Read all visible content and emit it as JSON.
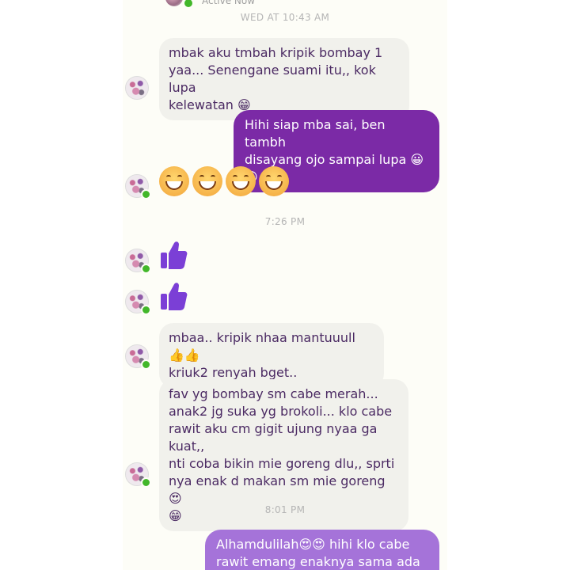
{
  "header": {
    "status": "Active Now"
  },
  "timestamps": {
    "t1": "WED AT 10:43 AM",
    "t2": "7:26 PM",
    "t3": "8:01 PM"
  },
  "messages": {
    "m1": "mbak aku tmbah kripik bombay 1\nyaa... Senengane suami itu,, kok lupa\nkelewatan 😁",
    "m2": "Hihi siap mba sai, ben tambh\ndisayang ojo sampai lupa 😀😀",
    "m3": "mbaa.. kripik nhaa mantuuull 👍👍\nkriuk2 renyah bget..",
    "m4": "fav yg bombay sm cabe merah...\nanak2 jg suka yg brokoli... klo cabe\nrawit aku cm gigit ujung nyaa ga kuat,,\nnti coba bikin mie goreng dlu,, sprti\nnya enak d makan sm mie goreng 😍\n😁",
    "m5": "Alhamdulilah😍😍 hihi klo cabe\nrawit emang enaknya sama ada"
  },
  "colors": {
    "outgoing": "#7b2aa6",
    "outgoing_light": "#a573d9",
    "incoming": "#f1f1ec",
    "incoming_text": "#4b2a63",
    "online": "#42b72a",
    "like": "#7b3fd6"
  },
  "icons": {
    "laugh": "grinning-face-with-smiling-eyes-icon",
    "like": "thumbs-up-icon",
    "online": "online-status-dot"
  }
}
